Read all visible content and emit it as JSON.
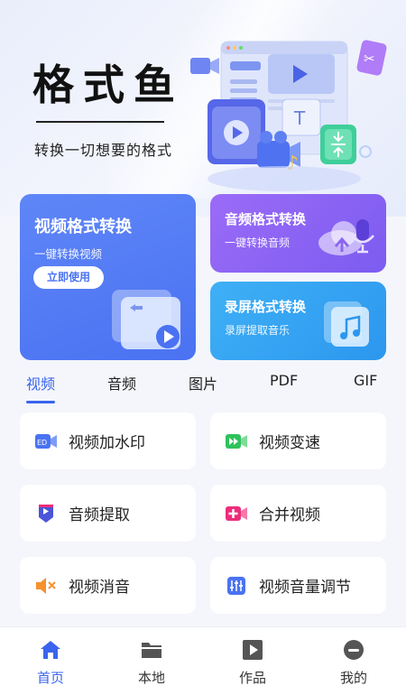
{
  "app": {
    "title": "格式鱼",
    "subtitle": "转换一切想要的格式"
  },
  "cards": {
    "video": {
      "title": "视频格式转换",
      "subtitle": "一键转换视频",
      "button": "立即使用"
    },
    "audio": {
      "title": "音频格式转换",
      "subtitle": "一键转换音频"
    },
    "screen": {
      "title": "录屏格式转换",
      "subtitle": "录屏提取音乐"
    }
  },
  "tabs": [
    {
      "label": "视频",
      "active": true
    },
    {
      "label": "音频",
      "active": false
    },
    {
      "label": "图片",
      "active": false
    },
    {
      "label": "PDF",
      "active": false
    },
    {
      "label": "GIF",
      "active": false
    }
  ],
  "tools": [
    {
      "label": "视频加水印",
      "icon": "watermark-icon",
      "color": "#4a72f2"
    },
    {
      "label": "视频变速",
      "icon": "fast-forward-icon",
      "color": "#2fc25b"
    },
    {
      "label": "音频提取",
      "icon": "extract-audio-icon",
      "color": "#4a55d8"
    },
    {
      "label": "合并视频",
      "icon": "merge-video-icon",
      "color": "#ee2d7a"
    },
    {
      "label": "视频消音",
      "icon": "mute-icon",
      "color": "#f5922e"
    },
    {
      "label": "视频音量调节",
      "icon": "volume-adjust-icon",
      "color": "#4a72f2"
    }
  ],
  "nav": [
    {
      "label": "首页",
      "icon": "home-icon",
      "active": true
    },
    {
      "label": "本地",
      "icon": "folder-icon",
      "active": false
    },
    {
      "label": "作品",
      "icon": "play-square-icon",
      "active": false
    },
    {
      "label": "我的",
      "icon": "profile-icon",
      "active": false
    }
  ],
  "colors": {
    "accent": "#3a64ee",
    "background": "#f4f6fb"
  }
}
